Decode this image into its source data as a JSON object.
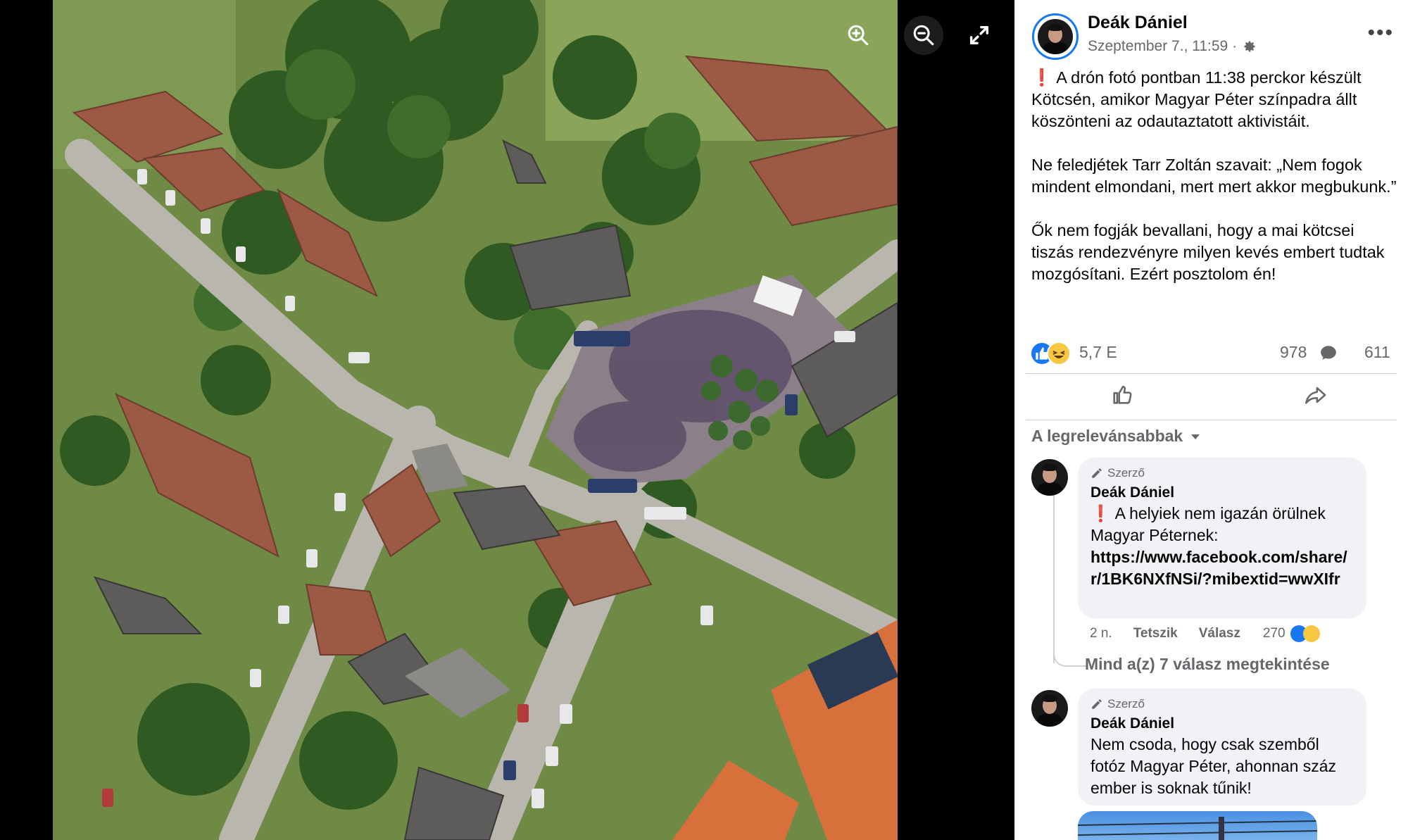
{
  "viewer": {
    "zoom_in_icon": "zoom-in-icon",
    "zoom_out_icon": "zoom-out-icon",
    "fullscreen_icon": "fullscreen-icon"
  },
  "post": {
    "author": "Deák Dániel",
    "timestamp": "Szeptember 7., 11:59 ·",
    "audience_icon": "gear-icon",
    "paragraphs": [
      "A drón fotó pontban 11:38 perckor készült Kötcsén, amikor Magyar Péter színpadra állt köszönteni az odautaztatott aktivistáit.",
      "Ne feledjétek Tarr Zoltán szavait: „Nem fogok mindent elmondani, mert mert akkor megbukunk.”",
      "Ők nem fogják bevallani, hogy a mai kötcsei tiszás rendezvényre milyen kevés embert tudtak mozgósítani. Ezért posztolom én!"
    ],
    "reaction_count": "5,7 E",
    "comment_count": "978",
    "share_count": "611"
  },
  "comments": {
    "sort_label": "A legrelevánsabbak",
    "items": [
      {
        "badge": "Szerző",
        "author": "Deák Dániel",
        "text": "A helyiek nem igazán örülnek Magyar Péternek:",
        "link": "https://www.facebook.com/share/r/1BK6NXfNSi/?mibextid=wwXIfr",
        "age": "2 n.",
        "like_label": "Tetszik",
        "reply_label": "Válasz",
        "reaction_count": "270"
      },
      {
        "badge": "Szerző",
        "author": "Deák Dániel",
        "text": "Nem csoda, hogy csak szemből fotóz Magyar Péter, ahonnan száz ember is soknak tűnik!"
      }
    ],
    "view_replies": "Mind a(z) 7 válasz megtekintése"
  },
  "colors": {
    "accent": "#1877f2",
    "secondary_text": "#65676b",
    "bubble": "#f0f2f5"
  }
}
